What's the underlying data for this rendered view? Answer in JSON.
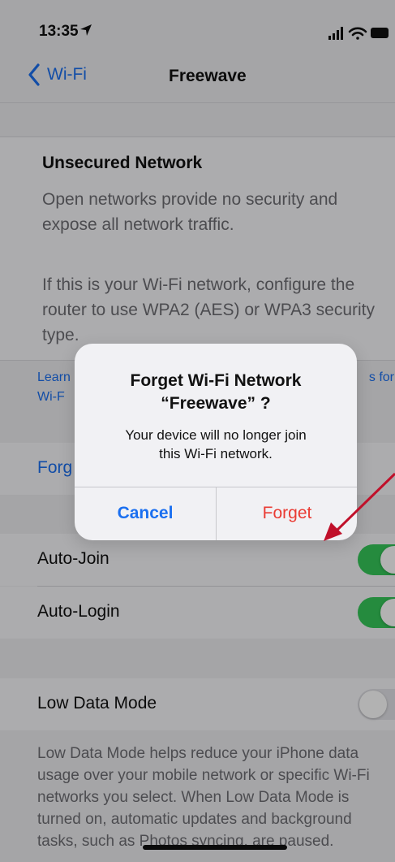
{
  "status_bar": {
    "time": "13:35",
    "location_icon": "location-arrow-icon",
    "signal_icon": "cellular-signal-icon",
    "wifi_icon": "wifi-icon",
    "battery_icon": "battery-icon"
  },
  "nav": {
    "back_label": "Wi-Fi",
    "title": "Freewave"
  },
  "security": {
    "heading": "Unsecured Network",
    "text1": "Open networks provide no security and expose all network traffic.",
    "text2": "If this is your Wi-Fi network, configure the router to use WPA2 (AES) or WPA3 security type."
  },
  "learn_more": {
    "line1_start": "Learn",
    "line1_end": "s for",
    "line2_start": "Wi-F"
  },
  "forget_row": {
    "label": "Forg"
  },
  "auto_join": {
    "label": "Auto-Join",
    "on": true
  },
  "auto_login": {
    "label": "Auto-Login",
    "on": true
  },
  "low_data": {
    "label": "Low Data Mode",
    "on": false
  },
  "low_data_note": "Low Data Mode helps reduce your iPhone data usage over your mobile network or specific Wi-Fi networks you select. When Low Data Mode is turned on, automatic updates and background tasks, such as Photos syncing, are paused.",
  "alert": {
    "title_line1": "Forget Wi-Fi Network",
    "title_line2": "“Freewave” ?",
    "message_line1": "Your device will no longer join",
    "message_line2": "this Wi-Fi network.",
    "cancel_label": "Cancel",
    "forget_label": "Forget"
  },
  "colors": {
    "accent": "#1a6ff0",
    "destructive": "#ea3b33",
    "toggle_on": "#35c759",
    "arrow": "#c0102a"
  }
}
